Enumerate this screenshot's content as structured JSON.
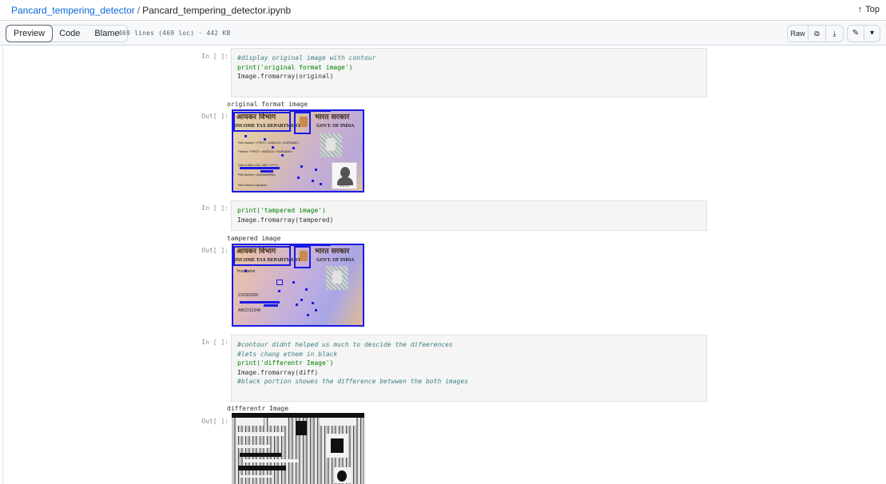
{
  "breadcrumb": {
    "repo": "Pancard_tempering_detector",
    "separator": "/",
    "file": "Pancard_tempering_detector.ipynb"
  },
  "top_link": {
    "label": "Top",
    "icon": "arrow-up-icon"
  },
  "toolbar": {
    "tabs": [
      "Preview",
      "Code",
      "Blame"
    ],
    "active_tab": "Preview",
    "meta": "469 lines (469 loc) · 442 KB",
    "raw_label": "Raw",
    "icons": [
      "copy-icon",
      "download-icon",
      "pencil-icon",
      "chevron-down-icon"
    ]
  },
  "cells": [
    {
      "in_prompt": "In [ ]:",
      "code": [
        {
          "type": "comment",
          "text": "#display original image with contour"
        },
        {
          "type": "code",
          "text": "print('original format image')"
        },
        {
          "type": "code",
          "text": "Image.fromarray(original)"
        }
      ],
      "stream": "original format image",
      "out_prompt": "Out[ ]:"
    },
    {
      "in_prompt": "In [ ]:",
      "code": [
        {
          "type": "code",
          "text": "print('tampered image')"
        },
        {
          "type": "code",
          "text": "Image.fromarray(tampered)"
        }
      ],
      "stream": "tampered image",
      "out_prompt": "Out[ ]:"
    },
    {
      "in_prompt": "In [ ]:",
      "code": [
        {
          "type": "comment",
          "text": "#contour didnt helped us much to descide the difeerences"
        },
        {
          "type": "comment",
          "text": "#lets chang ethem in black"
        },
        {
          "type": "code",
          "text": "print('differentr Image')"
        },
        {
          "type": "code",
          "text": "Image.fromarray(diff)"
        },
        {
          "type": "comment",
          "text": "#black portion showes the difference betwwen the both images"
        }
      ],
      "stream": "differentr Image",
      "out_prompt": "Out[ ]:"
    }
  ],
  "pan_card_original": {
    "hindi_left": "आयकर विभाग",
    "hindi_right": "भारत सरकार",
    "dept": "INCOME TAX DEPARTMENT",
    "govt": "GOVT. OF INDIA",
    "lines": [
      "PAN Holders' <FIRST> <MIDDLE> <SURNAME>",
      "Fathers' <FIRST> <MIDDLE> <SURNAME>",
      "Date of Birth <DD / MM / YYYY>",
      "PAN Number <AAAAA9999A>",
      "PAN Holders Signature"
    ],
    "photo_label": "PHOTO"
  },
  "pan_card_tampered": {
    "hindi_left": "आयकर विभाग",
    "hindi_right": "भारत सरकार",
    "dept": "INCOME TAX DEPARTMENT",
    "govt": "GOVT. OF INDIA",
    "name": "YourName",
    "dob": "21/03/2009",
    "pan": "ABCD1234A"
  },
  "colors": {
    "link": "#0969da",
    "contour": "#1a1ae6",
    "code_comment": "#408080",
    "code_string": "#ba2121"
  }
}
